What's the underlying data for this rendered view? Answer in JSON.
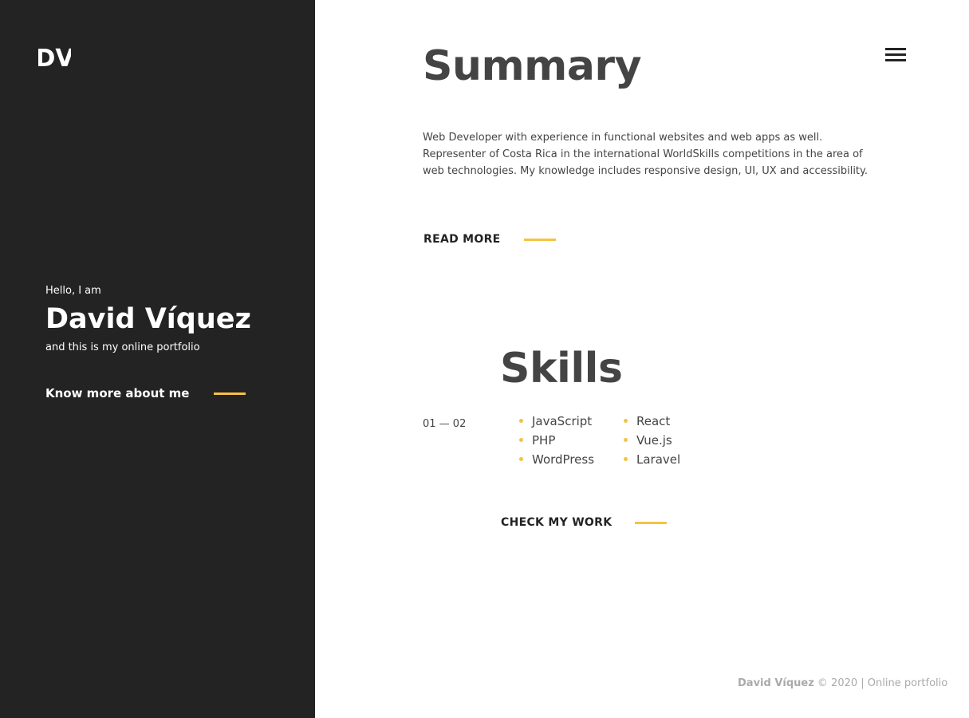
{
  "sidebar": {
    "logo": "DV",
    "greeting": "Hello, I am",
    "name": "David Víquez",
    "tagline": "and this is my online portfolio",
    "cta_label": "Know more about me"
  },
  "menu": {
    "icon": "hamburger-menu-icon"
  },
  "summary": {
    "title": "Summary",
    "text": "Web Developer with experience in functional websites and web apps as well. Representer of Costa Rica in the international WorldSkills competitions in the area of web technologies. My knowledge includes responsive design, UI, UX and accessibility.",
    "cta_label": "READ MORE"
  },
  "skills": {
    "title": "Skills",
    "counter": "01 — 02",
    "column_1": [
      "JavaScript",
      "PHP",
      "WordPress"
    ],
    "column_2": [
      "React",
      "Vue.js",
      "Laravel"
    ],
    "cta_label": "CHECK MY WORK"
  },
  "footer": {
    "name": "David Víquez",
    "rest": " © 2020 | Online portfolio"
  },
  "colors": {
    "sidebar_bg": "#232323",
    "accent": "#f5c243",
    "heading": "#444444"
  }
}
